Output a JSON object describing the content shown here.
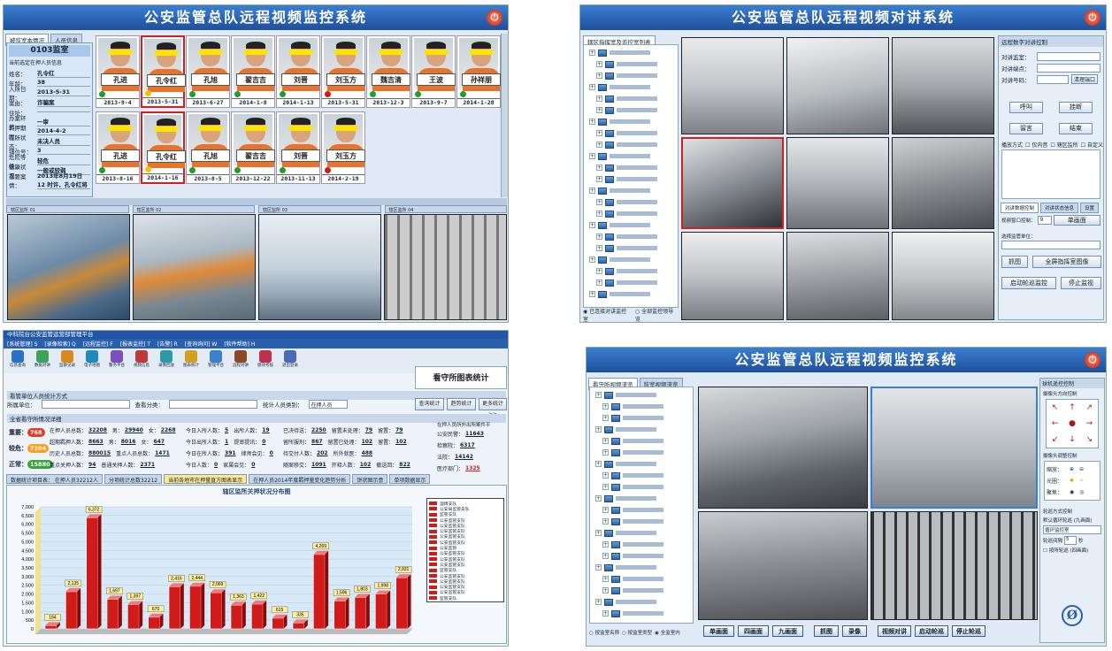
{
  "panel_tl": {
    "title": "公安监管总队远程视频监控系统",
    "tabs": [
      "被监室本情况",
      "人员信息"
    ],
    "room": "0103监室",
    "info_caption": "当前选定在押人员信息",
    "fields": [
      {
        "k": "姓名：",
        "v": "孔令红"
      },
      {
        "k": "年龄：",
        "v": "38"
      },
      {
        "k": "入所日期：",
        "v": "2013-5-31"
      },
      {
        "k": "案由：",
        "v": "诈骗案"
      },
      {
        "k": "住址：",
        "v": ""
      },
      {
        "k": "办案环节：",
        "v": "一审"
      },
      {
        "k": "羁押期限：",
        "v": "2014-4-2"
      },
      {
        "k": "在所状态：",
        "v": "未决人员"
      },
      {
        "k": "铺位号：",
        "v": "3"
      },
      {
        "k": "危险等级：",
        "v": "轻危"
      },
      {
        "k": "健康状况：",
        "v": "一般或较弱"
      },
      {
        "k": "重要案情：",
        "v": "2013年8月19日12 时许，孔令红将"
      }
    ],
    "row1": [
      {
        "name": "孔进",
        "date": "2013-9-4",
        "dot": "#1e9e2f"
      },
      {
        "name": "孔令红",
        "date": "2013-5-31",
        "dot": "#f2c300"
      },
      {
        "name": "孔旭",
        "date": "2013-6-27",
        "dot": "#1e9e2f"
      },
      {
        "name": "翟吉吉",
        "date": "2014-1-8",
        "dot": "#1e9e2f"
      },
      {
        "name": "刘晋",
        "date": "2014-1-13",
        "dot": "#1e9e2f"
      },
      {
        "name": "刘玉方",
        "date": "2013-5-31",
        "dot": "#d21919"
      },
      {
        "name": "魏吉清",
        "date": "2013-12-3",
        "dot": "#1e9e2f"
      },
      {
        "name": "王波",
        "date": "2013-9-7",
        "dot": "#1e9e2f"
      },
      {
        "name": "孙祥朋",
        "date": "2014-1-28",
        "dot": "#1e9e2f"
      }
    ],
    "row2": [
      {
        "name": "孔进",
        "date": "2013-8-16",
        "dot": "#1e9e2f"
      },
      {
        "name": "孔令红",
        "date": "2014-1-16",
        "dot": "#f2c300"
      },
      {
        "name": "孔旭",
        "date": "2013-8-5",
        "dot": "#1e9e2f"
      },
      {
        "name": "翟吉吉",
        "date": "2013-12-22",
        "dot": "#1e9e2f"
      },
      {
        "name": "刘晋",
        "date": "2013-11-13",
        "dot": "#1e9e2f"
      },
      {
        "name": "刘玉方",
        "date": "2014-2-19",
        "dot": "#d21919"
      }
    ]
  },
  "panel_tr": {
    "title": "公安监管总队远程视频对讲系统",
    "tree_tab": "辖区指挥室及监控室列表",
    "right_title": "远程数字对讲控制",
    "labels": [
      "对讲监室：",
      "对讲端点：",
      "对讲号码："
    ],
    "clear_btn": "清理端口",
    "btns": [
      "呼叫",
      "挂断",
      "留言",
      "结束"
    ],
    "mode_label": "播放方式",
    "checks": [
      "仅内音",
      "辖区监所",
      "自定义"
    ],
    "lower_tabs": [
      "对讲数据控制",
      "对讲状态信息",
      "设置"
    ],
    "split_label": "视频窗口控制：",
    "split_val": "9",
    "single_btn": "单画面",
    "unit_label": "选择监管单位：",
    "capture_btn": "抓图",
    "fullscreen_btn": "全屏指挥室图像",
    "auto_btn": "启动轮巡监控",
    "stop_btn": "停止监视",
    "radio1": "已连接对讲监控室",
    "radio2": "全部监控领导览"
  },
  "panel_bl": {
    "title": "中科院台公安监管运营部管理平台",
    "menu": [
      "[系统管理] S",
      "[录像检索] Q",
      "[远程监控] F",
      "[报表监控] T",
      "[告警] R",
      "[查询询问] W",
      "[软件帮助] H"
    ],
    "tools": [
      "信息查询",
      "数据对讲",
      "监察记录",
      "电子地图",
      "警务平台",
      "视频信息",
      "录像回放",
      "图表统计",
      "管理平台",
      "远程对讲",
      "绩效考核",
      "退出登录"
    ],
    "header_title": "看守所图表统计",
    "filter_caption": "看管单位人员统计方式",
    "unit_label": "所属单位：",
    "cat_label": "查看分类：",
    "person_label": "统计人员类别：",
    "person_val": "在押人员",
    "btns": [
      "查询统计",
      "趋势统计",
      "更多统计>>"
    ],
    "overview_caption": "全省看守所情况详细",
    "legend": [
      {
        "k": "重要：",
        "v": "768",
        "c": "#e0402a"
      },
      {
        "k": "较危：",
        "v": "7204",
        "c": "#ff9f1a"
      },
      {
        "k": "正常：",
        "v": "15880",
        "c": "#3aa33a"
      }
    ],
    "stats": [
      [
        "在押人员总数：",
        "32208",
        "男：",
        "29940",
        "女：",
        "2268"
      ],
      [
        "超期羁押人数：",
        "8663",
        "男：",
        "8016",
        "女：",
        "647"
      ],
      [
        "历史人员总数：",
        "880015",
        "重点人员总数：",
        "1471"
      ],
      [
        "重点关押人数：",
        "94",
        "普通关押人数：",
        "2371"
      ]
    ],
    "stats2": [
      [
        "今日入所人数：",
        "5",
        "出所人数：",
        "19"
      ],
      [
        "今日出所人数：",
        "1",
        "提审提讯：",
        "0"
      ],
      [
        "今日在所人数：",
        "391",
        "律师会见：",
        "0"
      ],
      [
        "今日人数：",
        "0",
        "家属会见：",
        "0"
      ]
    ],
    "stats3": [
      [
        "已决待送：",
        "2250",
        "留置未处理：",
        "79",
        "留置：",
        "79"
      ],
      [
        "留所服刑：",
        "867",
        "留置已处理：",
        "102",
        "留置：",
        "102"
      ],
      [
        "待交付人数：",
        "202",
        "所外就医：",
        "488"
      ],
      [
        "随案移交：",
        "1091",
        "开释人数：",
        "102",
        "撤送回：",
        "822"
      ]
    ],
    "stats4_title": "在押人员所外出所案件平",
    "stats4": [
      [
        "公安民警：",
        "11643"
      ],
      [
        "检察院：",
        "6317"
      ],
      [
        "法院：",
        "14142"
      ],
      [
        "医疗部门：",
        "1325"
      ]
    ],
    "bar_tabs": [
      "数据统计项目表： 在押人员32212人",
      "分项统计总数32212",
      "当前各地市在押量直方图表显示",
      "在押人员2014年度羁押量变化趋势分析",
      "饼状图示意",
      "单项数据显示"
    ],
    "chart_title": "辖区监所关押状况分布图"
  },
  "panel_br": {
    "title": "公安监管总队远程视频监控系统",
    "tabs": [
      "看守所视频流览",
      "监室视频流览"
    ],
    "ptz_title": "球机遥控控制",
    "ptz_group": "摄像头方向控制",
    "lens_group": "摄像头调整控制",
    "lens_rows": [
      "缩放：",
      "光圈：",
      "聚焦："
    ],
    "loop_group": "轮巡方式控制",
    "loop_default": "默认循环轮巡 (九画面)",
    "loop_sel": "循环监控室",
    "loop_interval": "轮巡间隔",
    "loop_interval_val": "5",
    "loop_unit": "秒",
    "loop_check": "按所轮巡 (四画面)",
    "radios": [
      "按监室名称",
      "按监室类型",
      "全监室内"
    ],
    "bottom_btns": [
      "单画面",
      "四画面",
      "九画面",
      "抓图",
      "录像",
      "视频对讲",
      "启动轮巡",
      "停止轮巡"
    ]
  },
  "chart_data": {
    "type": "bar",
    "title": "辖区监所关押状况分布图",
    "ylim": [
      0,
      7000
    ],
    "yticks": [
      0,
      500,
      1000,
      1500,
      2000,
      2500,
      3000,
      3500,
      4000,
      4500,
      5000,
      5500,
      6000,
      6500,
      7000
    ],
    "values": [
      184,
      2135,
      6372,
      1697,
      1397,
      670,
      2416,
      2444,
      2069,
      1363,
      1422,
      615,
      335,
      4269,
      1596,
      1803,
      1998,
      2931
    ],
    "legend_entries": [
      "淄博支队",
      "公安局监管支队",
      "监管支队",
      "公安监管支队",
      "公安监管支队",
      "公安监管支队",
      "公安监管支队",
      "公安监管支队",
      "公安监管",
      "公安监管支队",
      "公安监管支队",
      "公安监管支队",
      "监管支队",
      "公安监管支队",
      "公安监管支队",
      "公安监管支队",
      "公安监管支队",
      "监管支队"
    ]
  }
}
